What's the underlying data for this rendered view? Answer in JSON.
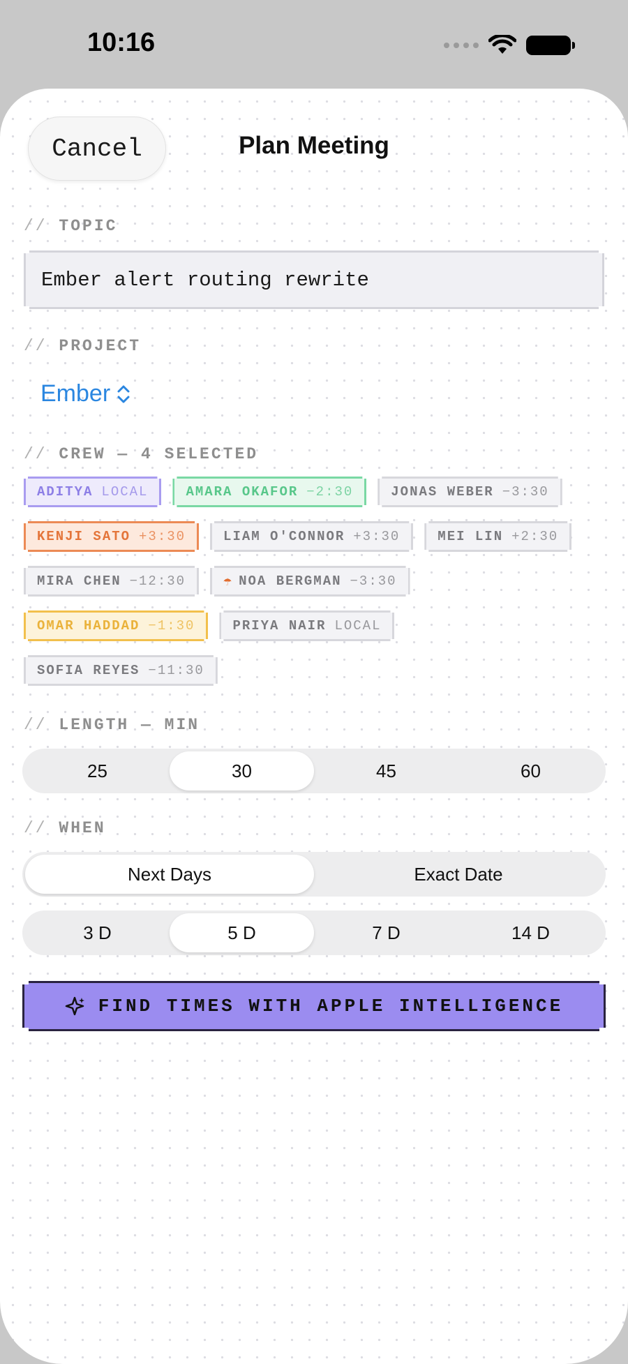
{
  "status_bar": {
    "time": "10:16"
  },
  "header": {
    "cancel_label": "Cancel",
    "title": "Plan Meeting"
  },
  "topic": {
    "label": "TOPIC",
    "value": "Ember alert routing rewrite"
  },
  "project": {
    "label": "PROJECT",
    "value": "Ember"
  },
  "crew": {
    "label": "CREW — 4 SELECTED",
    "rows": [
      [
        {
          "name": "ADITYA",
          "tz": "LOCAL",
          "color": "purple"
        },
        {
          "name": "AMARA OKAFOR",
          "tz": "−2:30",
          "color": "green"
        },
        {
          "name": "JONAS WEBER",
          "tz": "−3:30",
          "color": "gray"
        }
      ],
      [
        {
          "name": "KENJI SATO",
          "tz": "+3:30",
          "color": "orange"
        },
        {
          "name": "LIAM O'CONNOR",
          "tz": "+3:30",
          "color": "gray"
        },
        {
          "name": "MEI LIN",
          "tz": "+2:30",
          "color": "gray"
        }
      ],
      [
        {
          "name": "MIRA CHEN",
          "tz": "−12:30",
          "color": "gray"
        },
        {
          "name": "NOA BERGMAN",
          "tz": "−3:30",
          "color": "gray",
          "icon": "umbrella-icon"
        }
      ],
      [
        {
          "name": "OMAR HADDAD",
          "tz": "−1:30",
          "color": "yellow"
        },
        {
          "name": "PRIYA NAIR",
          "tz": "LOCAL",
          "color": "gray"
        }
      ],
      [
        {
          "name": "SOFIA REYES",
          "tz": "−11:30",
          "color": "gray"
        }
      ]
    ]
  },
  "length": {
    "label": "LENGTH — MIN",
    "options": [
      "25",
      "30",
      "45",
      "60"
    ],
    "selected": "30"
  },
  "when": {
    "label": "WHEN",
    "modes": [
      "Next Days",
      "Exact Date"
    ],
    "selected_mode": "Next Days",
    "days": [
      "3 D",
      "5 D",
      "7 D",
      "14 D"
    ],
    "selected_days": "5 D"
  },
  "find_button": {
    "label": "FIND TIMES WITH APPLE INTELLIGENCE",
    "icon": "sparkle-icon"
  },
  "colors": {
    "accent_blue": "#2a86e0",
    "button_purple": "#9b8cf0"
  }
}
